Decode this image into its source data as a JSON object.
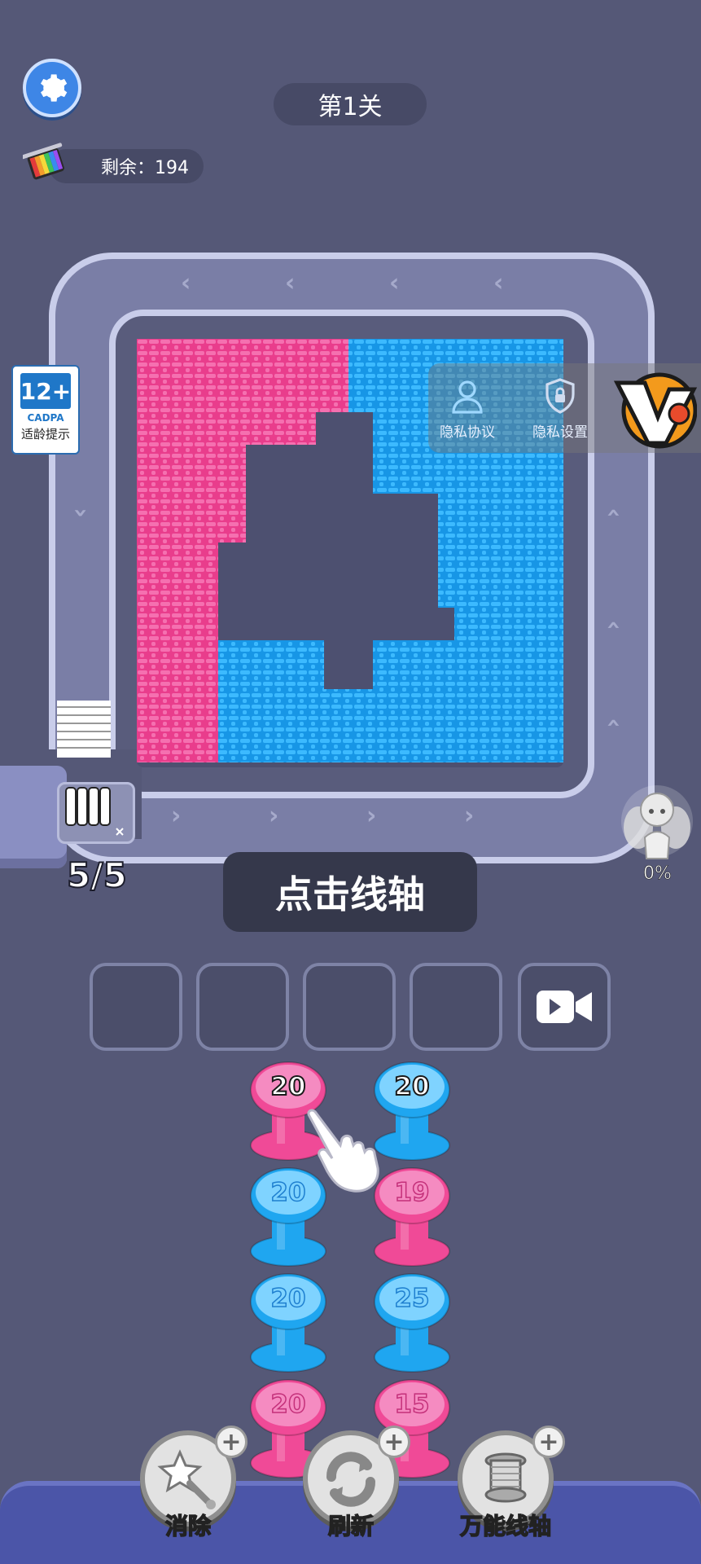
{
  "header": {
    "level_title": "第1关",
    "remaining_text": "剩余：194"
  },
  "age_rating": {
    "age": "12+",
    "org": "CADPA",
    "tip": "适龄提示"
  },
  "privacy": {
    "agreement_label": "隐私协议",
    "settings_label": "隐私设置"
  },
  "queue": {
    "count_text": "5/5"
  },
  "fairy": {
    "progress_text": "0%"
  },
  "hint": {
    "text": "点击线轴"
  },
  "colors": {
    "pink": "#f04a97",
    "blue": "#1fa6f0",
    "pink_light": "#f58bc1",
    "blue_light": "#7fd3ff"
  },
  "spools": {
    "left_column": [
      {
        "value": "20",
        "color": "pink",
        "active": true
      },
      {
        "value": "20",
        "color": "blue",
        "active": false
      },
      {
        "value": "20",
        "color": "blue",
        "active": false
      },
      {
        "value": "20",
        "color": "pink",
        "active": false
      }
    ],
    "right_column": [
      {
        "value": "20",
        "color": "blue",
        "active": true
      },
      {
        "value": "19",
        "color": "pink",
        "active": false
      },
      {
        "value": "25",
        "color": "blue",
        "active": false
      },
      {
        "value": "15",
        "color": "pink",
        "active": false
      }
    ]
  },
  "tools": [
    {
      "label": "消除",
      "icon": "star-wand-icon"
    },
    {
      "label": "刷新",
      "icon": "refresh-icon"
    },
    {
      "label": "万能线轴",
      "icon": "universal-spool-icon"
    }
  ]
}
